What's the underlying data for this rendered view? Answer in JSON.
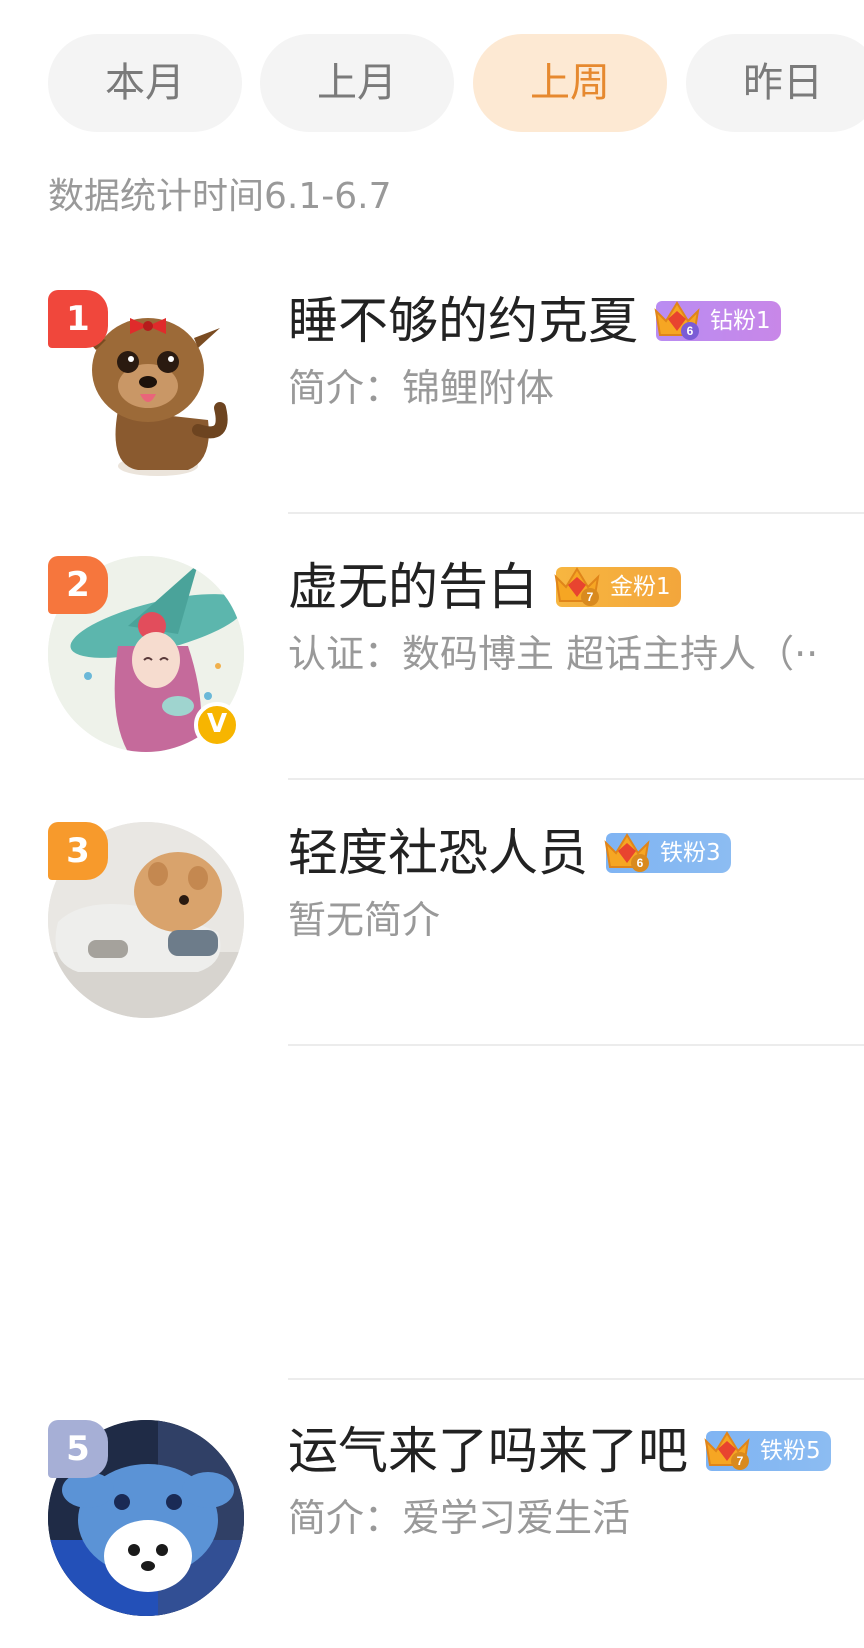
{
  "tabs": [
    {
      "label": "本月",
      "active": false
    },
    {
      "label": "上月",
      "active": false
    },
    {
      "label": "上周",
      "active": true
    },
    {
      "label": "昨日",
      "active": false
    }
  ],
  "colors": {
    "accent": "#e6892f",
    "accent_bg": "#fde9d3",
    "tab_bg": "#f4f4f4",
    "muted_text": "#999999",
    "rank1": "#f0473c",
    "rank2": "#f6763d",
    "rank3": "#f79a2c",
    "rank5": "#a6afd6"
  },
  "stats_period": "数据统计时间6.1-6.7",
  "ranking": [
    {
      "rank": "1",
      "name": "睡不够的约克夏",
      "badge_icon": "crown-icon",
      "badge_level": "6",
      "badge_text": "钻粉1",
      "badge_type": "diamond",
      "intro": "简介：锦鲤附体",
      "avatar": "yorkshire-puppy-avatar",
      "verified": false
    },
    {
      "rank": "2",
      "name": "虚无的告白",
      "badge_icon": "crown-icon",
      "badge_level": "7",
      "badge_text": "金粉1",
      "badge_type": "gold",
      "intro": "认证：数码博主 超话主持人（··",
      "avatar": "anime-witch-avatar",
      "verified": true,
      "verified_label": "V"
    },
    {
      "rank": "3",
      "name": "轻度社恐人员",
      "badge_icon": "crown-icon",
      "badge_level": "6",
      "badge_text": "铁粉3",
      "badge_type": "iron",
      "intro": "暂无简介",
      "avatar": "pomeranian-avatar",
      "verified": false
    },
    {
      "rank": "5",
      "name": "运气来了吗来了吧",
      "badge_icon": "crown-icon",
      "badge_level": "7",
      "badge_text": "铁粉5",
      "badge_type": "iron",
      "intro": "简介：爱学习爱生活",
      "avatar": "stitch-costume-dog-avatar",
      "verified": false
    }
  ]
}
